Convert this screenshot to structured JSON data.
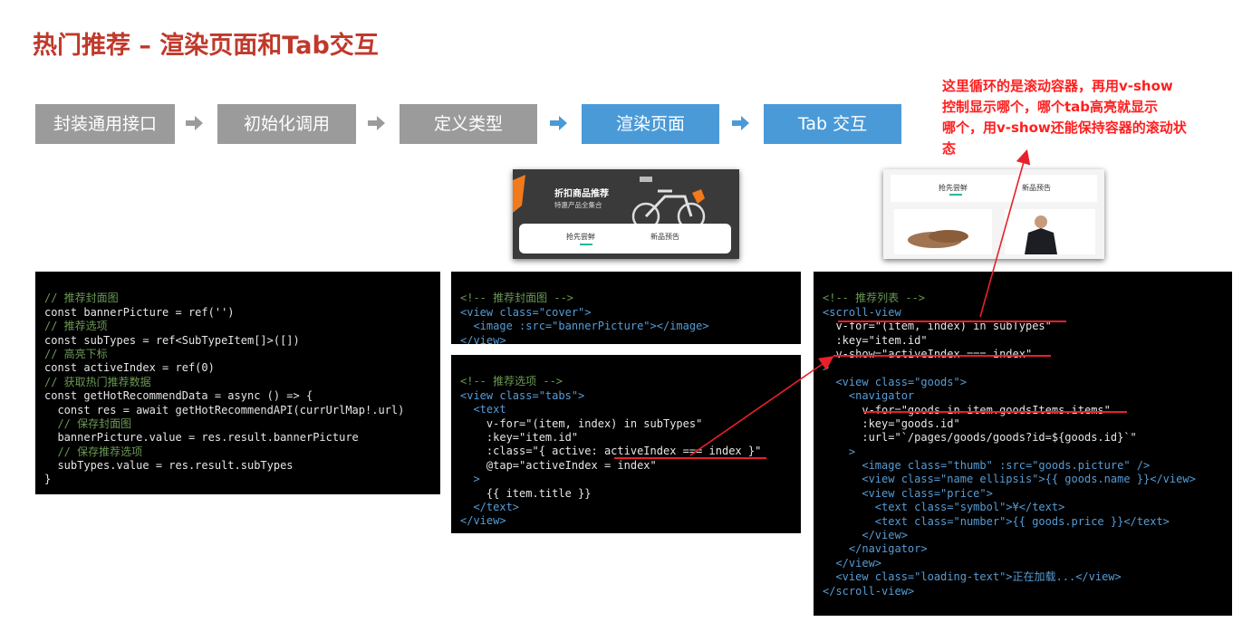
{
  "title": "热门推荐 – 渲染页面和Tab交互",
  "annotation": {
    "lines": [
      "这里循环的是滚动容器，再用v-show",
      "控制显示哪个，哪个tab高亮就显示",
      "哪个，用v-show还能保持容器的滚动状",
      "态"
    ]
  },
  "steps": [
    {
      "label": "封装通用接口",
      "state": "done"
    },
    {
      "label": "初始化调用",
      "state": "done"
    },
    {
      "label": "定义类型",
      "state": "done"
    },
    {
      "label": "渲染页面",
      "state": "active"
    },
    {
      "label": "Tab 交互",
      "state": "active"
    }
  ],
  "colors": {
    "title": "#c0392b",
    "annotation": "#ff1f1f",
    "step_done": "#9b9b9b",
    "step_active": "#4a9ad8",
    "underline": "#e8202a",
    "tab_active": "#27ba9b"
  },
  "screenshot_cover": {
    "heading": "折扣商品推荐",
    "subheading": "特惠产品全集合",
    "tabs": [
      "抢先尝鲜",
      "新品预告"
    ]
  },
  "screenshot_list": {
    "tabs": [
      "抢先尝鲜",
      "新品预告"
    ]
  },
  "code_script": [
    "// 推荐封面图",
    "const bannerPicture = ref('')",
    "// 推荐选项",
    "const subTypes = ref<SubTypeItem[]>([])",
    "// 高亮下标",
    "const activeIndex = ref(0)",
    "// 获取热门推荐数据",
    "const getHotRecommendData = async () => {",
    "  const res = await getHotRecommendAPI(currUrlMap!.url)",
    "  // 保存封面图",
    "  bannerPicture.value = res.result.bannerPicture",
    "  // 保存推荐选项",
    "  subTypes.value = res.result.subTypes",
    "}"
  ],
  "code_cover": [
    "<!-- 推荐封面图 -->",
    "<view class=\"cover\">",
    "  <image :src=\"bannerPicture\"></image>",
    "</view>"
  ],
  "code_tabs": [
    "<!-- 推荐选项 -->",
    "<view class=\"tabs\">",
    "  <text",
    "    v-for=\"(item, index) in subTypes\"",
    "    :key=\"item.id\"",
    "    :class=\"{ active: activeIndex === index }\"",
    "    @tap=\"activeIndex = index\"",
    "  >",
    "    {{ item.title }}",
    "  </text>",
    "</view>"
  ],
  "code_list": [
    "<!-- 推荐列表 -->",
    "<scroll-view",
    "  v-for=\"(item, index) in subTypes\"",
    "  :key=\"item.id\"",
    "  v-show=\"activeIndex === index\"",
    ">",
    "  <view class=\"goods\">",
    "    <navigator",
    "      v-for=\"goods in item.goodsItems.items\"",
    "      :key=\"goods.id\"",
    "      :url=\"`/pages/goods/goods?id=${goods.id}`\"",
    "    >",
    "      <image class=\"thumb\" :src=\"goods.picture\" />",
    "      <view class=\"name ellipsis\">{{ goods.name }}</view>",
    "      <view class=\"price\">",
    "        <text class=\"symbol\">¥</text>",
    "        <text class=\"number\">{{ goods.price }}</text>",
    "      </view>",
    "    </navigator>",
    "  </view>",
    "  <view class=\"loading-text\">正在加载...</view>",
    "</scroll-view>"
  ]
}
